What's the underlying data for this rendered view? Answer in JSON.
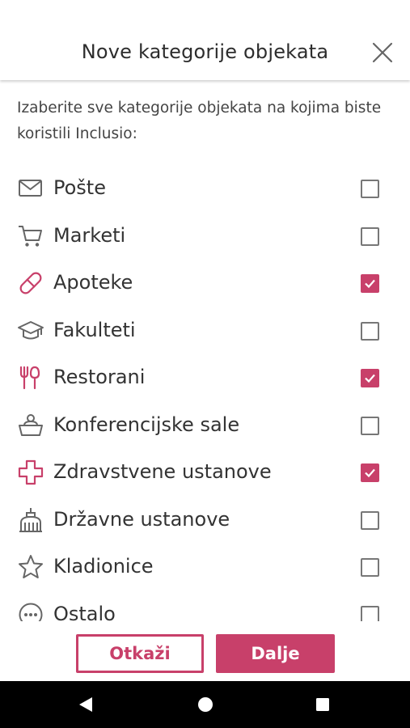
{
  "header": {
    "title": "Nove kategorije objekata"
  },
  "intro": "Izaberite sve kategorije objekata na kojima biste koristili Inclusio:",
  "accent_color": "#c8406a",
  "categories": [
    {
      "label": "Pošte",
      "icon": "mail-icon",
      "checked": false
    },
    {
      "label": "Marketi",
      "icon": "cart-icon",
      "checked": false
    },
    {
      "label": "Apoteke",
      "icon": "pill-icon",
      "checked": true
    },
    {
      "label": "Fakulteti",
      "icon": "graduation-cap-icon",
      "checked": false
    },
    {
      "label": "Restorani",
      "icon": "cutlery-icon",
      "checked": true
    },
    {
      "label": "Konferencijske sale",
      "icon": "conference-icon",
      "checked": false
    },
    {
      "label": "Zdravstvene ustanove",
      "icon": "medical-cross-icon",
      "checked": true
    },
    {
      "label": "Državne ustanove",
      "icon": "government-building-icon",
      "checked": false
    },
    {
      "label": "Kladionice",
      "icon": "star-icon",
      "checked": false
    },
    {
      "label": "Ostalo",
      "icon": "more-icon",
      "checked": false
    }
  ],
  "buttons": {
    "cancel": "Otkaži",
    "next": "Dalje"
  },
  "navbar": {
    "back": "back-icon",
    "home": "home-icon",
    "recents": "recents-icon"
  }
}
